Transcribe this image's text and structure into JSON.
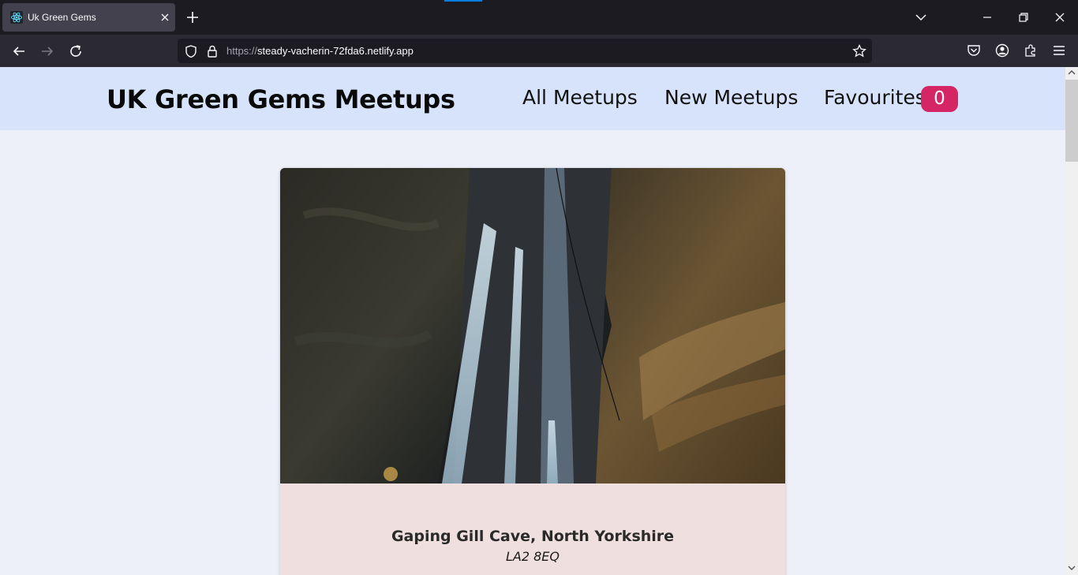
{
  "browser": {
    "tab_title": "Uk Green Gems",
    "url_scheme": "https://",
    "url_host": "steady-vacherin-72fda6.netlify.app"
  },
  "header": {
    "logo": "UK Green Gems Meetups",
    "nav": {
      "all": "All Meetups",
      "new": "New Meetups",
      "favourites": "Favourites",
      "favourites_count": "0"
    }
  },
  "meetup": {
    "title": "Gaping Gill Cave, North Yorkshire",
    "address": "LA2 8EQ"
  },
  "colors": {
    "header_bg": "#d6e3fa",
    "page_bg": "#eef0f9",
    "badge": "#d42665",
    "card_body": "#f0dfdf"
  },
  "icons": [
    "react-icon",
    "close-icon",
    "plus-icon",
    "chevron-down-icon",
    "minimize-icon",
    "restore-icon",
    "close-window-icon",
    "back-icon",
    "forward-icon",
    "reload-icon",
    "shield-icon",
    "lock-icon",
    "star-icon",
    "pocket-icon",
    "account-icon",
    "extensions-icon",
    "menu-icon"
  ]
}
